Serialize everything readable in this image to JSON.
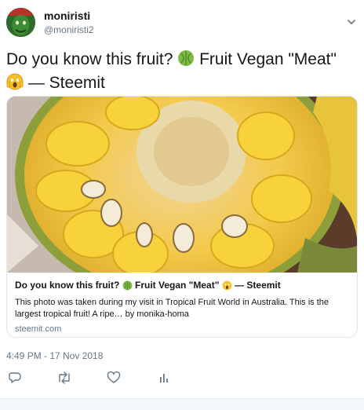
{
  "user": {
    "display_name": "moniristi",
    "handle": "@moniristi2"
  },
  "tweet": {
    "text_part1": "Do you know this fruit? ",
    "text_part2": " Fruit Vegan \"Meat\" ",
    "text_part3": " — Steemit",
    "timestamp": "4:49 PM - 17 Nov 2018"
  },
  "card": {
    "title_part1": "Do you know this fruit? ",
    "title_part2": " Fruit Vegan \"Meat\" ",
    "title_part3": " — Steemit",
    "description": "This photo was taken during my visit in Tropical Fruit World in Australia. This is the largest tropical fruit! A ripe… by monika-homa",
    "domain": "steemit.com"
  },
  "icons": {
    "fruit": "melon-icon",
    "scream": "face-screaming-icon",
    "reply": "reply-icon",
    "retweet": "retweet-icon",
    "like": "heart-icon",
    "analytics": "analytics-icon",
    "menu": "chevron-down-icon"
  },
  "colors": {
    "text": "#14171a",
    "secondary": "#657786",
    "border": "#e1e8ed"
  }
}
